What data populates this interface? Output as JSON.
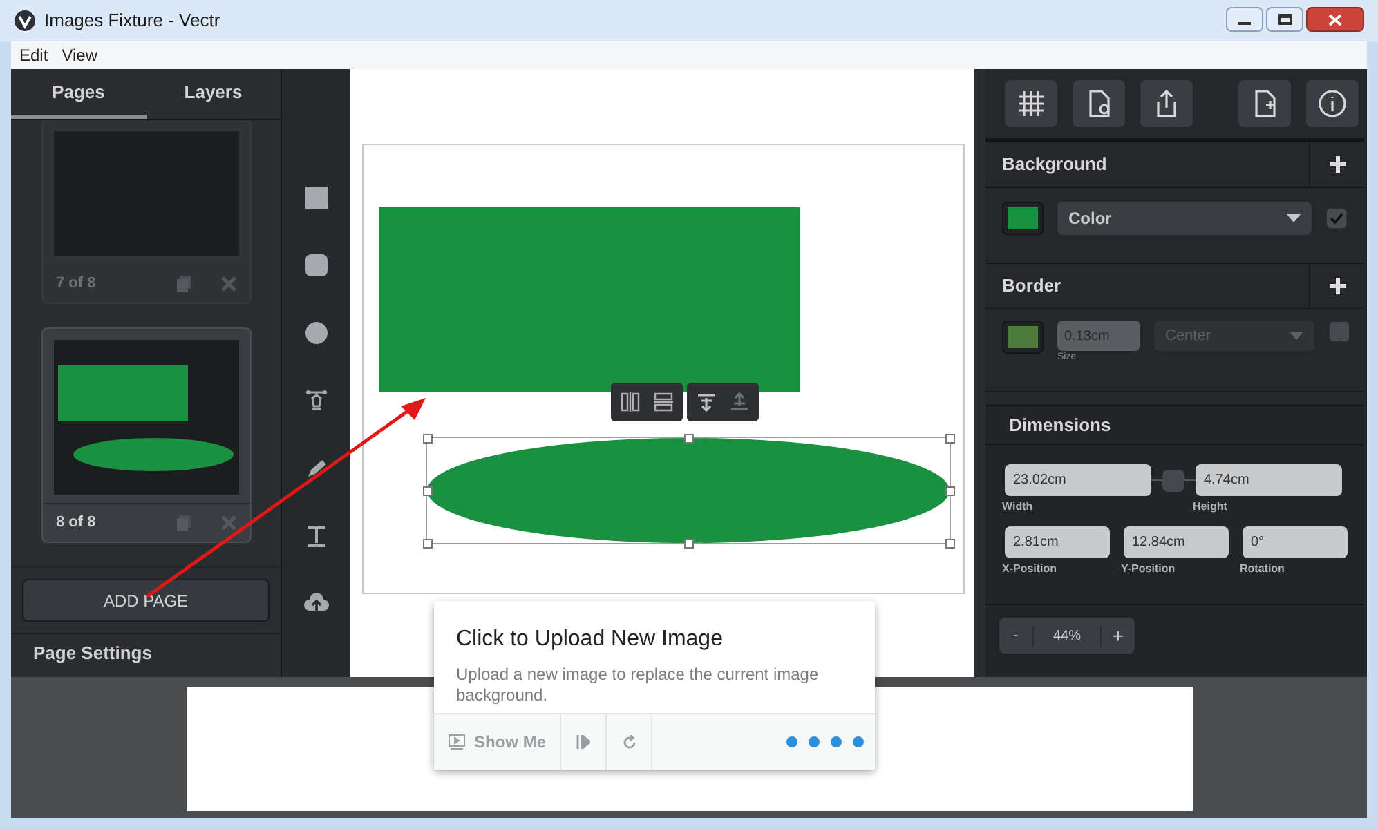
{
  "window": {
    "title": "Images Fixture - Vectr"
  },
  "menu": [
    "Edit",
    "View"
  ],
  "sidebar_tabs": [
    {
      "label": "Pages",
      "selected": true
    },
    {
      "label": "Layers",
      "selected": false
    }
  ],
  "pages": [
    {
      "label": "7 of 8",
      "kind": "empty",
      "selected": false
    },
    {
      "label": "8 of 8",
      "kind": "shapes",
      "selected": true
    }
  ],
  "add_page": "ADD PAGE",
  "page_settings": "Page Settings",
  "background": {
    "title": "Background",
    "color": "#1a9140",
    "fill_type": "Color",
    "enabled": true
  },
  "border": {
    "title": "Border",
    "color": "#4e7a3c",
    "size": "0.13cm",
    "size_label": "Size",
    "position": "Center",
    "enabled": false
  },
  "dimensions": {
    "title": "Dimensions",
    "locked": false,
    "fields": [
      {
        "label": "Width",
        "value": "23.02cm"
      },
      {
        "label": "Height",
        "value": "4.74cm"
      },
      {
        "label": "X-Position",
        "value": "2.81cm"
      },
      {
        "label": "Y-Position",
        "value": "12.84cm"
      },
      {
        "label": "Rotation",
        "value": "0°"
      }
    ]
  },
  "zoom": {
    "minus": "-",
    "value": "44%",
    "plus": "+"
  },
  "tour": {
    "title": "Click to Upload New Image",
    "text": "Upload a new image to replace the current image background.",
    "show_me": "Show Me",
    "steps": [
      {
        "selected": true
      },
      {
        "selected": true
      },
      {
        "selected": true
      },
      {
        "selected": true
      }
    ]
  }
}
